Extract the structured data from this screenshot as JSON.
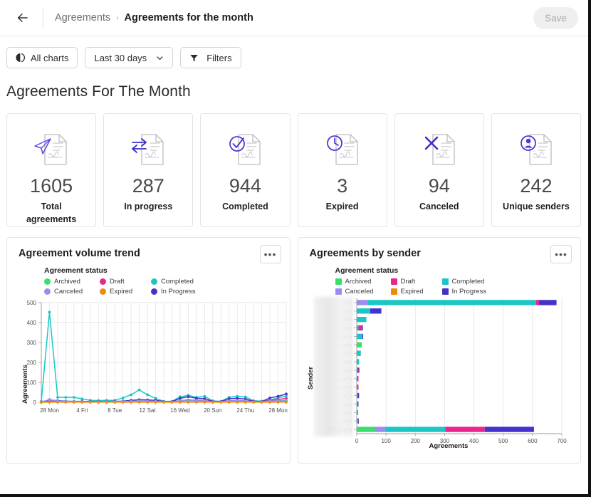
{
  "header": {
    "back_icon": "arrow-left-icon",
    "breadcrumb_root": "Agreements",
    "breadcrumb_separator": "›",
    "breadcrumb_current": "Agreements for the month",
    "save_label": "Save"
  },
  "toolbar": {
    "all_charts_label": "All charts",
    "all_charts_icon": "charts-icon",
    "date_range_label": "Last 30 days",
    "chevron_icon": "chevron-down-icon",
    "filters_label": "Filters",
    "filters_icon": "funnel-icon"
  },
  "page": {
    "title": "Agreements For The Month"
  },
  "cards": [
    {
      "value": "1605",
      "label": "Total agreements",
      "icon": "paper-plane-document-icon"
    },
    {
      "value": "287",
      "label": "In progress",
      "icon": "exchange-arrows-document-icon"
    },
    {
      "value": "944",
      "label": "Completed",
      "icon": "check-circle-document-icon"
    },
    {
      "value": "3",
      "label": "Expired",
      "icon": "clock-document-icon"
    },
    {
      "value": "94",
      "label": "Canceled",
      "icon": "x-mark-document-icon"
    },
    {
      "value": "242",
      "label": "Unique senders",
      "icon": "user-circle-document-icon"
    }
  ],
  "legend": {
    "title": "Agreement status",
    "items": [
      {
        "label": "Archived",
        "color": "#3ade6e"
      },
      {
        "label": "Draft",
        "color": "#e8268e"
      },
      {
        "label": "Completed",
        "color": "#1cc6c6"
      },
      {
        "label": "Canceled",
        "color": "#9b8cf0"
      },
      {
        "label": "Expired",
        "color": "#f08a0c"
      },
      {
        "label": "In Progress",
        "color": "#4432cc"
      }
    ]
  },
  "panels": {
    "volume": {
      "title": "Agreement volume trend",
      "more_label": "•••",
      "more_icon": "overflow-menu-icon"
    },
    "sender": {
      "title": "Agreements by sender",
      "more_label": "•••",
      "more_icon": "overflow-menu-icon"
    }
  },
  "chart_data": [
    {
      "type": "line",
      "title": "Agreement volume trend",
      "xlabel": "",
      "ylabel": "Agreements",
      "ylim": [
        0,
        500
      ],
      "yticks": [
        0,
        100,
        200,
        300,
        400,
        500
      ],
      "xticks": [
        "28 Mon",
        "4 Fri",
        "8 Tue",
        "12 Sat",
        "16 Wed",
        "20 Sun",
        "24 Thu",
        "28 Mon"
      ],
      "xtick_positions": [
        1,
        5,
        9,
        13,
        17,
        21,
        25,
        29
      ],
      "grid": true,
      "legend": "top-left",
      "x": [
        0,
        1,
        2,
        3,
        4,
        5,
        6,
        7,
        8,
        9,
        10,
        11,
        12,
        13,
        14,
        15,
        16,
        17,
        18,
        19,
        20,
        21,
        22,
        23,
        24,
        25,
        26,
        27,
        28,
        29,
        30
      ],
      "series": [
        {
          "name": "Completed",
          "color": "#1cc6c6",
          "values": [
            4,
            452,
            25,
            25,
            25,
            17,
            10,
            9,
            10,
            10,
            22,
            38,
            62,
            38,
            20,
            5,
            5,
            28,
            35,
            25,
            30,
            7,
            5,
            25,
            30,
            27,
            8,
            6,
            12,
            22,
            32
          ]
        },
        {
          "name": "In Progress",
          "color": "#4432cc",
          "values": [
            2,
            12,
            8,
            6,
            5,
            5,
            4,
            4,
            4,
            5,
            6,
            10,
            13,
            12,
            10,
            4,
            4,
            20,
            28,
            20,
            18,
            5,
            4,
            18,
            20,
            16,
            5,
            4,
            22,
            30,
            42
          ]
        },
        {
          "name": "Draft",
          "color": "#e8268e",
          "values": [
            1,
            6,
            5,
            4,
            4,
            3,
            3,
            3,
            3,
            3,
            4,
            5,
            6,
            6,
            5,
            3,
            3,
            8,
            12,
            10,
            9,
            3,
            3,
            8,
            9,
            8,
            3,
            3,
            9,
            14,
            20
          ]
        },
        {
          "name": "Canceled",
          "color": "#9b8cf0",
          "values": [
            1,
            14,
            6,
            5,
            4,
            3,
            2,
            2,
            3,
            3,
            4,
            5,
            7,
            6,
            5,
            2,
            2,
            7,
            10,
            8,
            7,
            2,
            2,
            7,
            8,
            7,
            2,
            2,
            6,
            8,
            10
          ]
        },
        {
          "name": "Archived",
          "color": "#3ade6e",
          "values": [
            0,
            2,
            2,
            2,
            2,
            1,
            1,
            1,
            1,
            1,
            2,
            2,
            3,
            2,
            2,
            1,
            1,
            3,
            4,
            3,
            3,
            1,
            1,
            3,
            3,
            3,
            1,
            1,
            3,
            4,
            5
          ]
        },
        {
          "name": "Expired",
          "color": "#f08a0c",
          "values": [
            0,
            1,
            1,
            1,
            1,
            1,
            1,
            1,
            1,
            1,
            1,
            1,
            1,
            1,
            1,
            1,
            1,
            1,
            1,
            1,
            1,
            1,
            1,
            1,
            1,
            1,
            1,
            1,
            1,
            1,
            1
          ]
        }
      ]
    },
    {
      "type": "bar",
      "orientation": "horizontal",
      "stacked": true,
      "title": "Agreements by sender",
      "xlabel": "Agreements",
      "ylabel": "Sender",
      "xlim": [
        0,
        700
      ],
      "xticks": [
        0,
        100,
        200,
        300,
        400,
        500,
        600,
        700
      ],
      "grid": true,
      "legend": "top-left",
      "categories": [
        "...com",
        "...com",
        "...com",
        "...com",
        "...com",
        "...com",
        "...com",
        "...com",
        "...com",
        "...com",
        "...com",
        "...com",
        "...com",
        "...com",
        "...com",
        "All Others"
      ],
      "series": [
        {
          "name": "Archived",
          "color": "#3ade6e",
          "values": [
            0,
            0,
            0,
            0,
            0,
            17,
            0,
            0,
            0,
            0,
            1,
            0,
            0,
            0,
            0,
            62
          ]
        },
        {
          "name": "Canceled",
          "color": "#9b8cf0",
          "values": [
            38,
            0,
            0,
            0,
            0,
            0,
            0,
            0,
            0,
            0,
            0,
            0,
            0,
            0,
            0,
            35
          ]
        },
        {
          "name": "Completed",
          "color": "#1cc6c6",
          "values": [
            574,
            46,
            33,
            6,
            19,
            0,
            14,
            8,
            2,
            2,
            1,
            3,
            3,
            5,
            4,
            205
          ]
        },
        {
          "name": "Draft",
          "color": "#e8268e",
          "values": [
            10,
            0,
            0,
            12,
            0,
            0,
            0,
            0,
            4,
            4,
            4,
            0,
            0,
            0,
            0,
            135
          ]
        },
        {
          "name": "Expired",
          "color": "#f08a0c",
          "values": [
            0,
            0,
            0,
            0,
            0,
            0,
            0,
            0,
            0,
            0,
            0,
            0,
            0,
            0,
            0,
            0
          ]
        },
        {
          "name": "In Progress",
          "color": "#4432cc",
          "values": [
            60,
            38,
            0,
            3,
            3,
            0,
            0,
            0,
            2,
            0,
            0,
            5,
            1,
            0,
            1,
            168
          ]
        }
      ],
      "totals": [
        682,
        84,
        33,
        21,
        22,
        17,
        14,
        8,
        8,
        6,
        6,
        8,
        4,
        5,
        5,
        605
      ]
    }
  ]
}
